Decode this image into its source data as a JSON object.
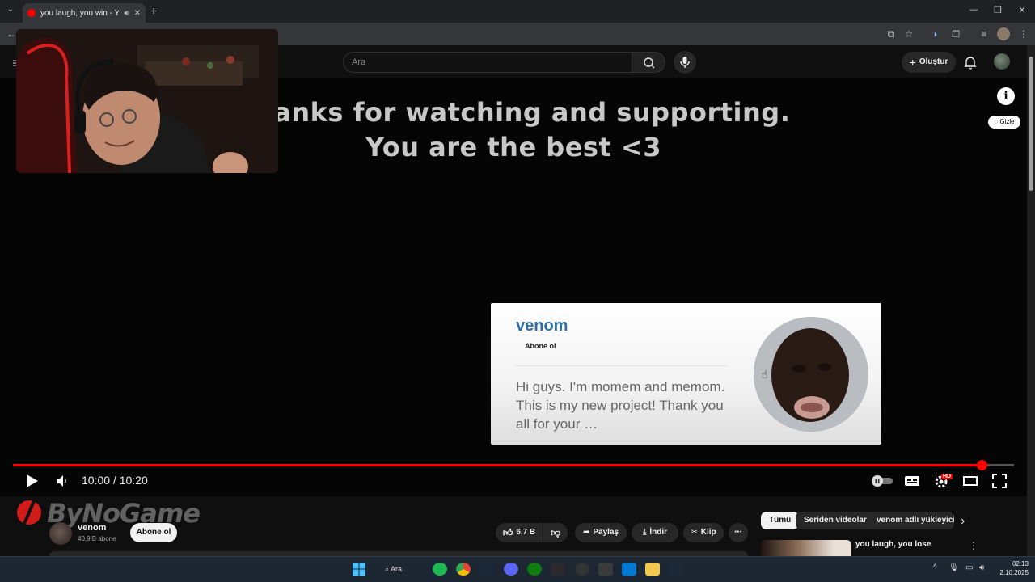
{
  "browser": {
    "tab_title": "you laugh, you win - YouTube",
    "tab_close": "✕",
    "new_tab": "+",
    "window_controls": [
      "—",
      "❐",
      "✕"
    ]
  },
  "youtube": {
    "search_placeholder": "Ara",
    "create_label": "Oluştur",
    "icons": [
      "menu-icon",
      "search-icon",
      "mic-icon",
      "bell-icon"
    ]
  },
  "video": {
    "overlay_line1": "Thanks for watching and supporting.",
    "overlay_line2": "You are the best <3",
    "info_label": "i",
    "hide_label": "Gizle",
    "time_display": "10:00 / 10:20",
    "progress_fraction": 0.968,
    "hd_badge": "HD"
  },
  "endcard": {
    "channel_name": "venom",
    "subscribe_label": "Abone ol",
    "description": "Hi guys. I'm momem and memom. This is my new project! Thank you all for your …"
  },
  "below_player": {
    "watermark": "ByNoGame",
    "channel_name": "venom",
    "subscribers": "40,9 B abone",
    "subscribe_button": "Abone ol",
    "likes": "6,7 B",
    "share": "Paylaş",
    "download": "İndir",
    "clip": "Klip",
    "more": "⋯"
  },
  "sidebar": {
    "chips": [
      "Tümü",
      "Seriden videolar",
      "venom adlı yükleyicid"
    ],
    "next_arrow": "›",
    "rec_title": "you laugh, you lose",
    "rec_more": "⋮"
  },
  "taskbar": {
    "search_label": "Ara",
    "time": "02:13",
    "date": "2.10.2025"
  },
  "colors": {
    "accent_red": "#ff0000",
    "card_name_blue": "#2d6fa5"
  }
}
